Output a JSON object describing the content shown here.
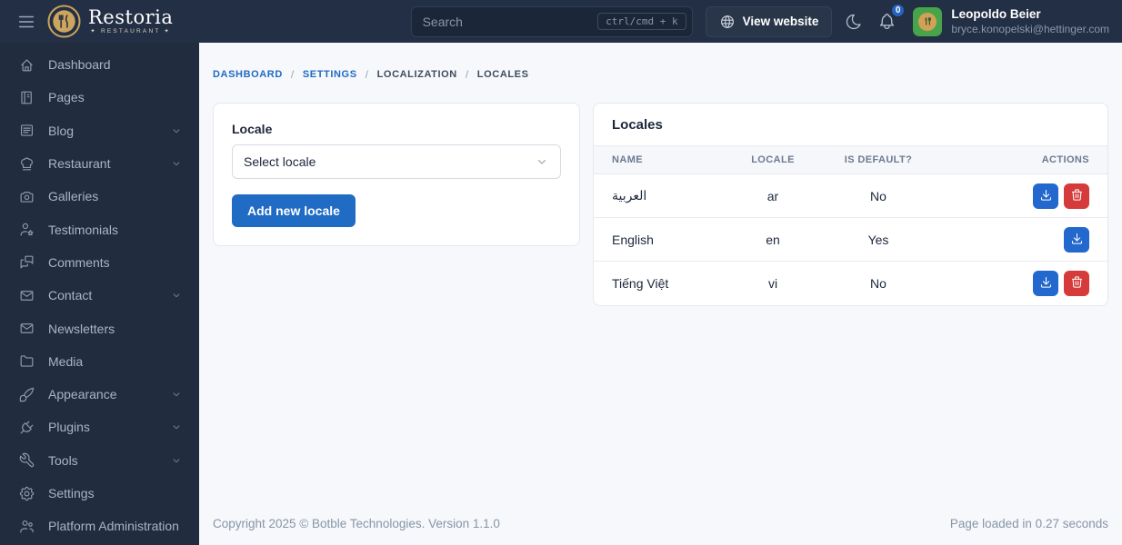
{
  "brand": {
    "name": "Restoria",
    "tagline": "✦ RESTAURANT ✦",
    "logo_icon": "utensils-icon"
  },
  "topbar": {
    "search": {
      "placeholder": "Search",
      "shortcut": "ctrl/cmd + k"
    },
    "view_website_label": "View website",
    "notification_count": "0",
    "user": {
      "name": "Leopoldo Beier",
      "email": "bryce.konopelski@hettinger.com"
    }
  },
  "sidebar": {
    "items": [
      {
        "label": "Dashboard",
        "icon": "home-icon",
        "expandable": false
      },
      {
        "label": "Pages",
        "icon": "notebook-icon",
        "expandable": false
      },
      {
        "label": "Blog",
        "icon": "article-icon",
        "expandable": true
      },
      {
        "label": "Restaurant",
        "icon": "chef-hat-icon",
        "expandable": true
      },
      {
        "label": "Galleries",
        "icon": "camera-icon",
        "expandable": false
      },
      {
        "label": "Testimonials",
        "icon": "user-star-icon",
        "expandable": false
      },
      {
        "label": "Comments",
        "icon": "messages-icon",
        "expandable": false
      },
      {
        "label": "Contact",
        "icon": "mail-icon",
        "expandable": true
      },
      {
        "label": "Newsletters",
        "icon": "mail-icon",
        "expandable": false
      },
      {
        "label": "Media",
        "icon": "folder-icon",
        "expandable": false
      },
      {
        "label": "Appearance",
        "icon": "brush-icon",
        "expandable": true
      },
      {
        "label": "Plugins",
        "icon": "plug-icon",
        "expandable": true
      },
      {
        "label": "Tools",
        "icon": "tool-icon",
        "expandable": true
      },
      {
        "label": "Settings",
        "icon": "settings-icon",
        "expandable": false
      },
      {
        "label": "Platform Administration",
        "icon": "users-icon",
        "expandable": false
      }
    ]
  },
  "breadcrumb": [
    {
      "label": "DASHBOARD",
      "is_link": true
    },
    {
      "label": "SETTINGS",
      "is_link": true
    },
    {
      "label": "LOCALIZATION",
      "is_link": false
    },
    {
      "label": "LOCALES",
      "is_link": false
    }
  ],
  "locale_form": {
    "label": "Locale",
    "select_value": "Select locale",
    "add_button_label": "Add new locale"
  },
  "locales_table": {
    "title": "Locales",
    "columns": [
      "NAME",
      "LOCALE",
      "IS DEFAULT?",
      "ACTIONS"
    ],
    "rows": [
      {
        "name": "العربية",
        "locale": "ar",
        "is_default": "No",
        "actions": [
          "download",
          "delete"
        ]
      },
      {
        "name": "English",
        "locale": "en",
        "is_default": "Yes",
        "actions": [
          "download"
        ]
      },
      {
        "name": "Tiếng Việt",
        "locale": "vi",
        "is_default": "No",
        "actions": [
          "download",
          "delete"
        ]
      }
    ]
  },
  "footer": {
    "copyright": "Copyright 2025 © Botble Technologies. Version 1.1.0",
    "load_time": "Page loaded in 0.27 seconds"
  },
  "colors": {
    "primary": "#206bc4",
    "danger": "#d63b3b",
    "topbar_bg": "#232f44",
    "sidebar_bg": "#212c3e",
    "content_bg": "#f6f8fb",
    "badge_bg": "#2563c0",
    "avatar_bg": "#47a44b",
    "logo_gold": "#cda55e"
  }
}
